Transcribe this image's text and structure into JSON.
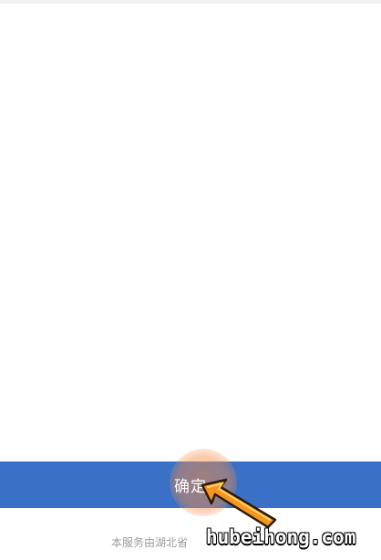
{
  "button": {
    "confirm_label": "确定"
  },
  "footer": {
    "service_text": "本服务由湖北省"
  },
  "watermark": {
    "text": "hubeihong.com"
  },
  "colors": {
    "button_bg": "#3a71c6",
    "tap_highlight": "#f58c46",
    "arrow_orange": "#f5961e"
  },
  "icons": {
    "pointer": "orange-arrow-icon"
  }
}
